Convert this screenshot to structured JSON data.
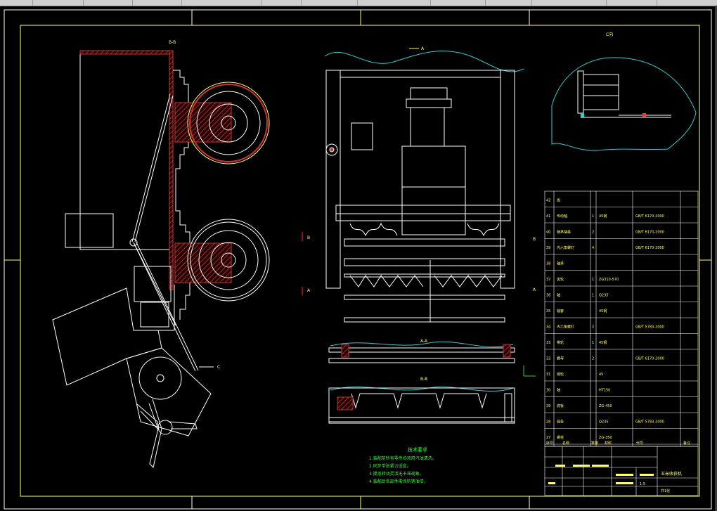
{
  "colors": {
    "background": "#000000",
    "frame": "#ffff66",
    "geometry": "#ffffff",
    "hatch": "#cc3333",
    "cut_line": "#33cccc",
    "notes": "#33ff33",
    "table_text": "#ffff66",
    "ucs_icon": "#33cc33"
  },
  "view_labels": {
    "left_view": "B-B",
    "front_view": "A",
    "section_aa": "A-A",
    "section_bb": "B-B",
    "detail_c": "C向",
    "arrow_c": "C",
    "mark_a_left": "A",
    "mark_b_left": "B",
    "mark_a_right": "A",
    "mark_b_right": "B"
  },
  "technical_requirements": {
    "title": "技术要求",
    "items": [
      "1.装配前所有零件均须用汽油清洗。",
      "2.同步带张紧力适宜。",
      "3.搅龙转动灵活无卡滞现象。",
      "4.装配后各部件需涂防锈油漆。"
    ]
  },
  "bom": {
    "columns": [
      "序号",
      "代号",
      "名称",
      "数量",
      "材料",
      "备注"
    ],
    "rows": [
      {
        "no": "42",
        "name": "齿",
        "qty": "",
        "material": "",
        "code": ""
      },
      {
        "no": "41",
        "name": "传动轴",
        "qty": "1",
        "material": "45钢",
        "code": "GB/T 6170-2000"
      },
      {
        "no": "40",
        "name": "轴承端盖",
        "qty": "2",
        "material": "",
        "code": "GB/T 6170-2000"
      },
      {
        "no": "39",
        "name": "内六角螺钉",
        "qty": "4",
        "material": "",
        "code": "GB/T 6170-2000"
      },
      {
        "no": "38",
        "name": "轴承",
        "qty": "",
        "material": "",
        "code": ""
      },
      {
        "no": "37",
        "name": "齿轮",
        "qty": "1",
        "material": "ZG310-570",
        "code": ""
      },
      {
        "no": "36",
        "name": "轴",
        "qty": "1",
        "material": "Q235",
        "code": ""
      },
      {
        "no": "35",
        "name": "轴套",
        "qty": "",
        "material": "45钢",
        "code": ""
      },
      {
        "no": "34",
        "name": "内六角螺钉",
        "qty": "2",
        "material": "",
        "code": "GB/T 5783-2000"
      },
      {
        "no": "33",
        "name": "带轮",
        "qty": "1",
        "material": "45钢",
        "code": ""
      },
      {
        "no": "32",
        "name": "螺母",
        "qty": "2",
        "material": "",
        "code": "GB/T 6170-2000"
      },
      {
        "no": "31",
        "name": "链轮",
        "qty": "",
        "material": "45",
        "code": ""
      },
      {
        "no": "30",
        "name": "轴",
        "qty": "",
        "material": "HT150",
        "code": ""
      },
      {
        "no": "29",
        "name": "底板",
        "qty": "",
        "material": "ZG-450",
        "code": ""
      },
      {
        "no": "28",
        "name": "链条",
        "qty": "",
        "material": "Q235",
        "code": "GB/T 5783-2000"
      },
      {
        "no": "27",
        "name": "螺栓",
        "qty": "",
        "material": "ZG-350",
        "code": ""
      }
    ],
    "title_block": {
      "drawing_name": "玉米收获机",
      "scale": "1:5",
      "sheet": "共1张"
    }
  }
}
